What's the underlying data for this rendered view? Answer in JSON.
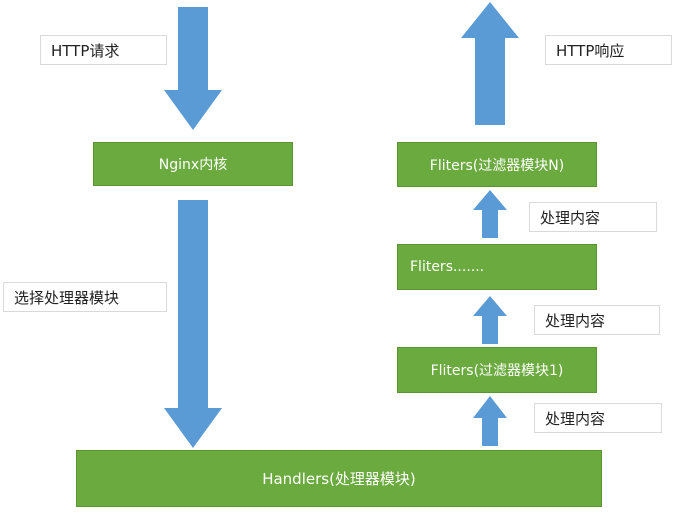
{
  "colors": {
    "arrow": "#5b9bd5",
    "box_green": "#6aaa3e",
    "label_border": "#d9d9d9"
  },
  "labels": {
    "http_request": "HTTP请求",
    "http_response": "HTTP响应",
    "select_handler": "选择处理器模块",
    "process_1": "处理内容",
    "process_2": "处理内容",
    "process_3": "处理内容"
  },
  "boxes": {
    "nginx_core": "Nginx内核",
    "filter_n": "Fliters(过滤器模块N)",
    "filter_mid": "Fliters.......",
    "filter_1": "Fliters(过滤器模块1)",
    "handlers": "Handlers(处理器模块)"
  }
}
